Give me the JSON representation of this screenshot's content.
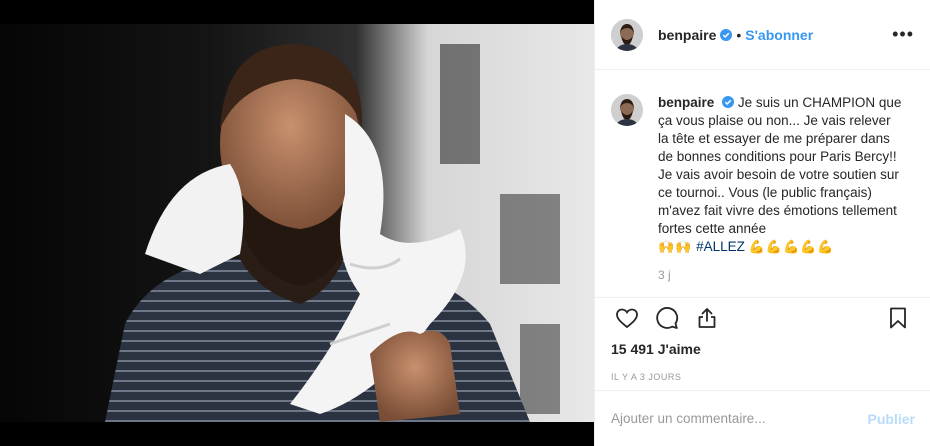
{
  "post": {
    "image_alt": "Tennis player with white towel draped over shoulder",
    "header": {
      "username": "benpaire",
      "verified": true,
      "separator": "•",
      "follow_label": "S'abonner",
      "more_icon": "more-horizontal-icon",
      "more_label": "•••"
    },
    "caption": {
      "username": "benpaire",
      "text": "Je suis un CHAMPION que ça vous plaise ou non... Je vais relever la tête et essayer de me préparer dans de bonnes conditions pour Paris Bercy!! Je vais avoir besoin de votre soutien sur ce tournoi.. Vous (le public français) m'avez fait vivre des émotions tellement fortes cette année",
      "emoji_before": "🙌🙌",
      "hashtag": "#ALLEZ",
      "emoji_after": "💪💪💪💪💪",
      "time": "3 j"
    },
    "actions": {
      "like_icon": "heart-icon",
      "comment_icon": "comment-icon",
      "share_icon": "share-icon",
      "save_icon": "bookmark-icon"
    },
    "likes": "15 491 J'aime",
    "posted_ago": "IL Y A 3 JOURS",
    "comment_box": {
      "placeholder": "Ajouter un commentaire...",
      "post_label": "Publier"
    }
  }
}
